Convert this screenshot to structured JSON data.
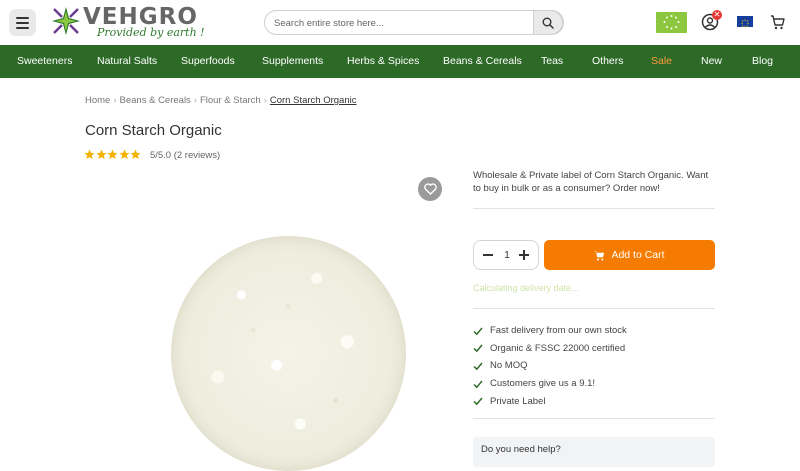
{
  "header": {
    "logo_name": "VEHGRO",
    "logo_tagline": "Provided by earth !",
    "search_placeholder": "Search entire store here...",
    "account_badge": "✕"
  },
  "nav": {
    "items": [
      {
        "label": "Sweeteners"
      },
      {
        "label": "Natural Salts"
      },
      {
        "label": "Superfoods"
      },
      {
        "label": "Supplements"
      },
      {
        "label": "Herbs & Spices"
      },
      {
        "label": "Beans & Cereals"
      },
      {
        "label": "Teas"
      },
      {
        "label": "Others"
      },
      {
        "label": "Sale"
      },
      {
        "label": "New"
      },
      {
        "label": "Blog"
      }
    ]
  },
  "breadcrumb": [
    "Home",
    "Beans & Cereals",
    "Flour & Starch",
    "Corn Starch Organic"
  ],
  "product": {
    "title": "Corn Starch Organic",
    "rating": 5,
    "rating_text": "5/5.0 (2 reviews)",
    "description": "Wholesale & Private label of Corn Starch Organic. Want to buy in bulk or as a consumer? Order now!",
    "quantity": "1",
    "add_to_cart_label": "Add to Cart",
    "delivery_text": "Calculating delivery date...",
    "usps": [
      "Fast delivery from our own stock",
      "Organic & FSSC 22000 certified",
      "No MOQ",
      "Customers give us a 9.1!",
      "Private Label"
    ],
    "help_text": "Do you need help?"
  },
  "colors": {
    "nav_bg": "#2d6a27",
    "accent_orange": "#f57c00",
    "sale": "#ff9a3c",
    "star": "#f5b301",
    "check": "#2d6a27"
  }
}
